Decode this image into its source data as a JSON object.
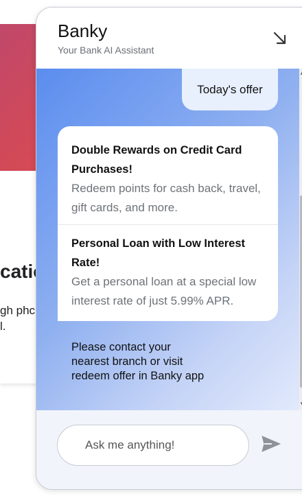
{
  "background": {
    "heading_fragment": "catio",
    "text_line_1": "gh phc",
    "text_line_2": "l."
  },
  "chat": {
    "title": "Banky",
    "subtitle": "Your Bank AI Assistant",
    "minimize_icon": "arrow-down-right-icon",
    "user_message": "Today's offer",
    "offers": [
      {
        "title": "Double Rewards on Credit Card Purchases!",
        "description": "Redeem points for cash back, travel, gift cards, and more."
      },
      {
        "title": "Personal Loan with Low Interest Rate!",
        "description": "Get a personal loan at a special low interest rate of just 5.99% APR."
      }
    ],
    "bot_message": "Please contact your nearest branch or visit redeem offer in Banky app",
    "input_placeholder": "Ask me anything!",
    "send_icon": "send-icon"
  },
  "colors": {
    "gradient_start": "#5b8def",
    "gradient_end": "#e3eafc",
    "hero_red": "#d84a52"
  }
}
